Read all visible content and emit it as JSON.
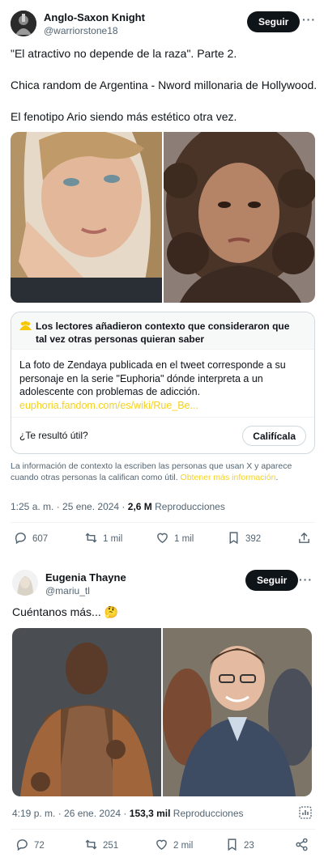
{
  "tweet1": {
    "author_name": "Anglo-Saxon Knight",
    "author_handle": "@warriorstone18",
    "follow_label": "Seguir",
    "more_label": "···",
    "text_line1": "\"El atractivo no depende de la raza\". Parte 2.",
    "text_line2": "Chica random de Argentina - Nword millonaria de Hollywood.",
    "text_line3": "El fenotipo Ario siendo más estético otra vez.",
    "note": {
      "title": "Los lectores añadieron contexto que consideraron que tal vez otras personas quieran saber",
      "body": "La foto de Zendaya publicada en el tweet corresponde a su personaje en la serie \"Euphoria\" dónde interpreta a un adolescente con problemas de adicción.",
      "link": "euphoria.fandom.com/es/wiki/Rue_Be...",
      "question": "¿Te resultó útil?",
      "rate_label": "Califícala"
    },
    "disclaimer": "La información de contexto la escriben las personas que usan X y aparece cuando otras personas la califican como útil.",
    "disclaimer_link": "Obtener más información",
    "time": "1:25 a. m. · 25 ene. 2024 · ",
    "views_count": "2,6 M",
    "views_label": " Reproducciones",
    "replies": "607",
    "retweets": "1 mil",
    "likes": "1 mil",
    "bookmarks": "392"
  },
  "tweet2": {
    "author_name": "Eugenia Thayne",
    "author_handle": "@mariu_tl",
    "follow_label": "Seguir",
    "more_label": "···",
    "text": "Cuéntanos más... 🤔",
    "time": "4:19 p. m. · 26 ene. 2024 · ",
    "views_count": "153,3 mil",
    "views_label": " Reproducciones",
    "replies": "72",
    "retweets": "251",
    "likes": "2 mil",
    "bookmarks": "23"
  },
  "colors": {
    "text": "#0f1419",
    "secondary": "#536471",
    "border": "#cfd9de",
    "link_yellow": "#f4d11e",
    "note_people": "#f5c800"
  }
}
